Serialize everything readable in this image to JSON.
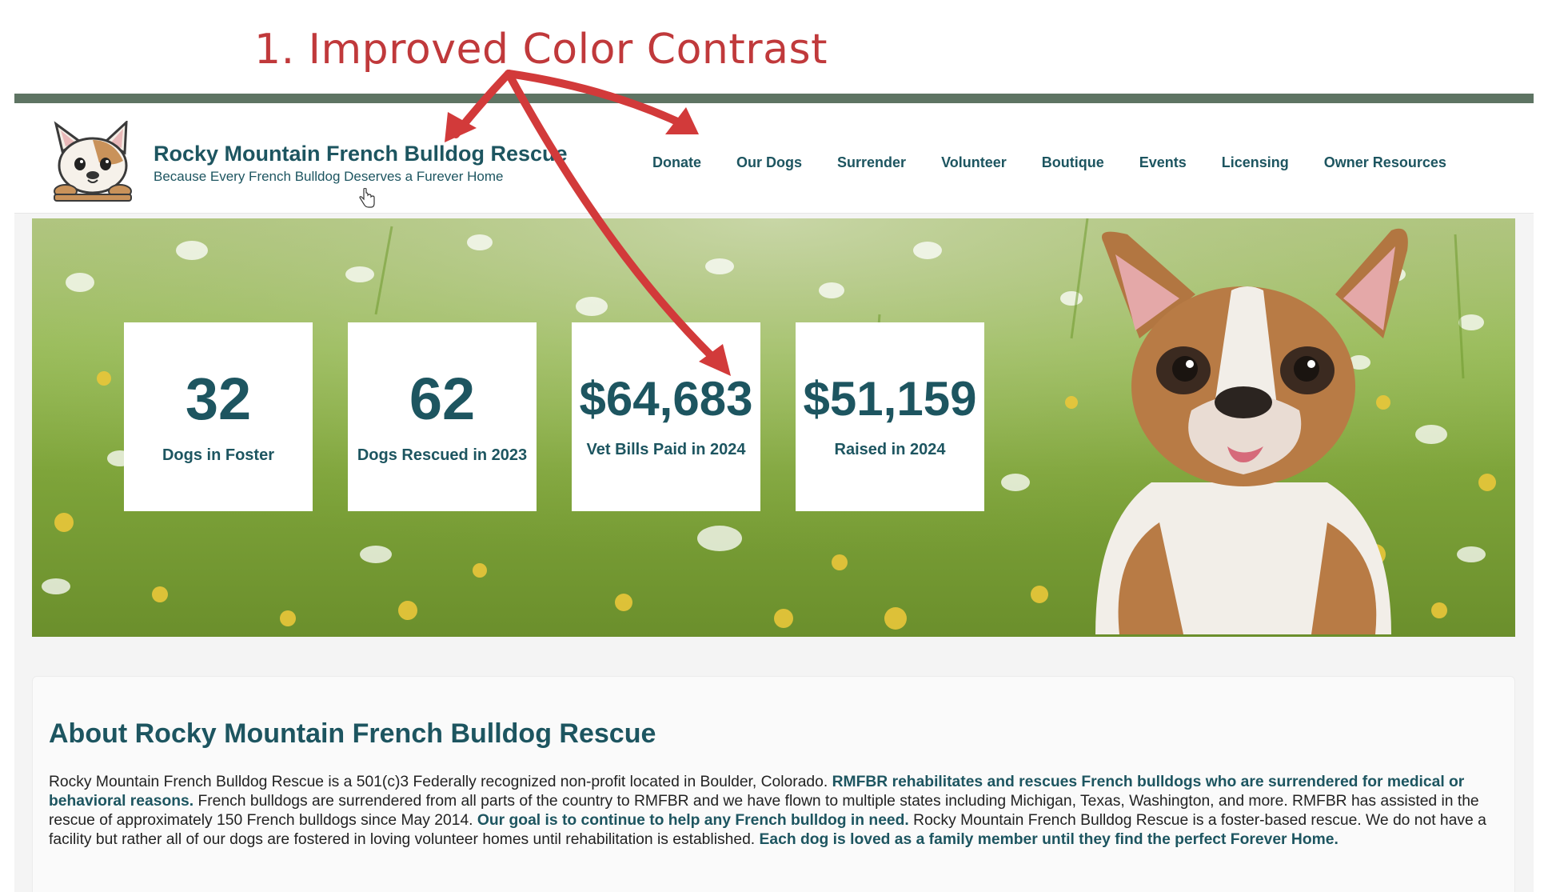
{
  "annotation": {
    "title": "1. Improved Color Contrast",
    "color": "#d23a3a"
  },
  "colors": {
    "brand_teal": "#1d5560",
    "top_bar": "#5e7463",
    "annotation_red": "#d23a3a"
  },
  "header": {
    "title": "Rocky Mountain French Bulldog Rescue",
    "tagline": "Because Every French Bulldog Deserves a Furever Home",
    "logo_icon": "french-bulldog-logo-icon"
  },
  "nav": {
    "items": [
      {
        "label": "Donate"
      },
      {
        "label": "Our Dogs"
      },
      {
        "label": "Surrender"
      },
      {
        "label": "Volunteer"
      },
      {
        "label": "Boutique"
      },
      {
        "label": "Events"
      },
      {
        "label": "Licensing"
      },
      {
        "label": "Owner Resources"
      }
    ]
  },
  "stats": [
    {
      "value": "32",
      "label": "Dogs in Foster"
    },
    {
      "value": "62",
      "label": "Dogs Rescued in 2023"
    },
    {
      "value": "$64,683",
      "label": "Vet Bills Paid in 2024"
    },
    {
      "value": "$51,159",
      "label": "Raised in 2024"
    }
  ],
  "about": {
    "title": "About Rocky Mountain French Bulldog Rescue",
    "p1": "Rocky Mountain French Bulldog Rescue is a 501(c)3 Federally recognized non-profit located in Boulder, Colorado. ",
    "h1": "RMFBR rehabilitates and rescues French bulldogs who are surrendered for medical or behavioral reasons.",
    "p2": " French bulldogs are surrendered from all parts of the country to RMFBR and we have flown to multiple states including Michigan, Texas, Washington, and more. RMFBR has assisted in the rescue of approximately 150 French bulldogs since May 2014. ",
    "h2": "Our goal is to continue to help any French bulldog in need.",
    "p3": " Rocky Mountain French Bulldog Rescue is a foster-based rescue. We do not have a facility but rather all of our dogs are fostered in loving volunteer homes until rehabilitation is established. ",
    "h3": "Each dog is loved as a family member until they find the perfect Forever Home."
  }
}
